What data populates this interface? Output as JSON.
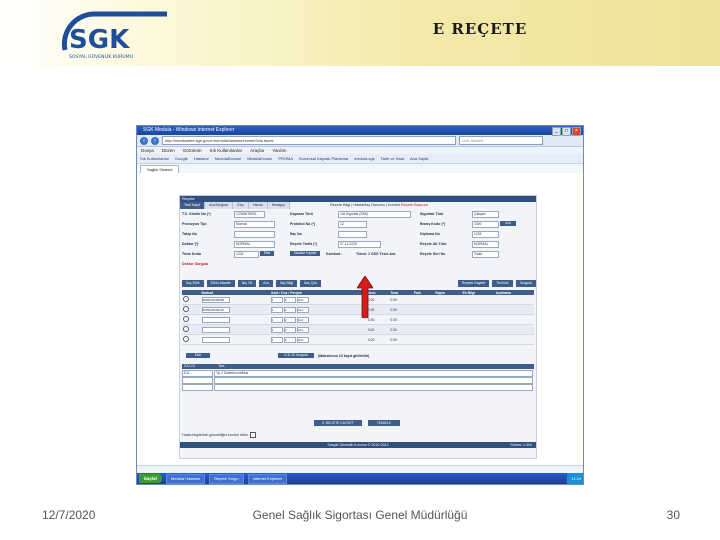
{
  "slide": {
    "title": "E REÇETE",
    "footer_date": "12/7/2020",
    "footer_center": "Genel Sağlık Sigortası Genel Müdürlüğü",
    "page_number": "30"
  },
  "logo": {
    "text": "SGK",
    "subtitle": "SOSYAL GÜVENLİK KURUMU"
  },
  "browser": {
    "title": "SGK Medula - Windows Internet Explorer",
    "url": "http://medicanee.sgk.gov.tr/medula/hastane/receteGiris.faces",
    "search_placeholder": "Live Search",
    "menu": [
      "Dosya",
      "Düzen",
      "Görünüm",
      "Sık Kullanılanlar",
      "Araçlar",
      "Yardım"
    ],
    "favorites": [
      "Sık Kullanılanlar",
      "Google",
      "Hastane",
      "MedulaEczane",
      "MedulaEczacı",
      "PROMA",
      "Kurumsal Kaynak Planlama",
      "medula.sgk",
      "Tarih ve Saat",
      "Ana Sayfa"
    ],
    "tab": "Sağlık Sistemi",
    "taskbar": {
      "start": "başlat",
      "items": [
        "Medula Hastane",
        "Reçete Sorgu",
        "Internet Explorer"
      ],
      "clock": "11:24"
    }
  },
  "form": {
    "title": "Reçete",
    "top_tabs": [
      "Yeni Kayıt",
      "Ara/Sorgula",
      "Güç",
      "Yazdır",
      "Hesapçı"
    ],
    "breadcrumb_plain": "Reçete Bilgi | Hasta/İlaç Durumu | Kontrol ",
    "breadcrumb_red": "Reçete Başvuru",
    "fields": {
      "tc_label": "T.C. Kimlik No (*)",
      "tc_value": "12345678901",
      "provizyon_label": "Provizyon Tipi",
      "provizyon_value": "Normal",
      "takip_label": "Takip No",
      "takip_value": "",
      "doktor_label": "Doktor (*)",
      "doktor_value": "NORMAL",
      "tesis_label": "Tesis Kodu",
      "tesis_value": "1234",
      "tarih_label": "Reçete Tarihi (*)",
      "tarih_value": "07.12.2020",
      "ilac_label": "İlaç No",
      "ilac_value": "",
      "kapsam_label": "Kapsam Türü",
      "kapsam_value": "4/A Sigortalı (SSK)",
      "protokol_label": "Protokol No (*)",
      "protokol_value": "12",
      "sigortali_label": "Sigortalı Türü",
      "sigortali_value": "Çalışan",
      "brans_label": "Branş Kodu (*)",
      "brans_value": "1000",
      "diploma_label": "Diploma No",
      "diploma_value": "1234",
      "alt_label": "Reçete Alt Türü",
      "alt_value": "NORMAL",
      "ara_btn": "Ara",
      "ekle_btn": "Ekle",
      "tahsilat_btn": "Tahsilat Kaydet",
      "karekod_label": "Karekod :",
      "seri_label": "Reçete Seri No",
      "seri_value": "Ticari",
      "tum_label": "Tümü: 1 GSS Tesis Ara",
      "red_label": "Doktor Sorgula"
    },
    "actions": [
      "İlaç Ekle",
      "Etkin Madde",
      "İlaç Sil",
      "Ara",
      "İlaç Bilgi",
      "İlaç Çek"
    ],
    "right_actions": [
      "Reçete Kaydet",
      "Temizle",
      "Sorgula"
    ],
    "table_headers": [
      "",
      "Barkod",
      "Adet / Doz / Periyot",
      "",
      "Kutu",
      "Tutar",
      "Fark",
      "Rapor",
      "Ek Bilgi",
      "Açıklama"
    ],
    "rows": [
      {
        "barkod": "8699522095656",
        "adet": "1",
        "doz": "2",
        "periyot": "Gün",
        "kutu": "0.00",
        "tutar": "0.00"
      },
      {
        "barkod": "8699536090115",
        "adet": "1",
        "doz": "2",
        "periyot": "Gün",
        "kutu": "0.00",
        "tutar": "0.00"
      },
      {
        "barkod": "",
        "adet": "1",
        "doz": "2",
        "periyot": "Gün",
        "kutu": "0.00",
        "tutar": "0.00"
      },
      {
        "barkod": "",
        "adet": "1",
        "doz": "2",
        "periyot": "Gün",
        "kutu": "0.00",
        "tutar": "0.00"
      },
      {
        "barkod": "",
        "adet": "1",
        "doz": "2",
        "periyot": "Gün",
        "kutu": "0.00",
        "tutar": "0.00"
      }
    ],
    "under_table_btn": "Ekle",
    "under_table_btn2": "ICD-10 Sorgula",
    "under_table_note": "(Maksimum 10 kayıt girilebilir)",
    "diag_headers": [
      "ICD-10",
      "Tanı"
    ],
    "diag_rows": [
      {
        "code": "E11",
        "text": "Tip 2 Diabetes mellitus"
      },
      {
        "code": "",
        "text": ""
      },
      {
        "code": "",
        "text": ""
      }
    ],
    "save_buttons": [
      "E-RECETE KAYDET",
      "TEMIZLE"
    ],
    "checkbox_label": "Hasta bilgilerinin güncelliğini kontrol ettim",
    "copyright": "Sosyal Güvenlik Kurumu © 2010-2012",
    "version": "Sürüm: 1.304"
  }
}
